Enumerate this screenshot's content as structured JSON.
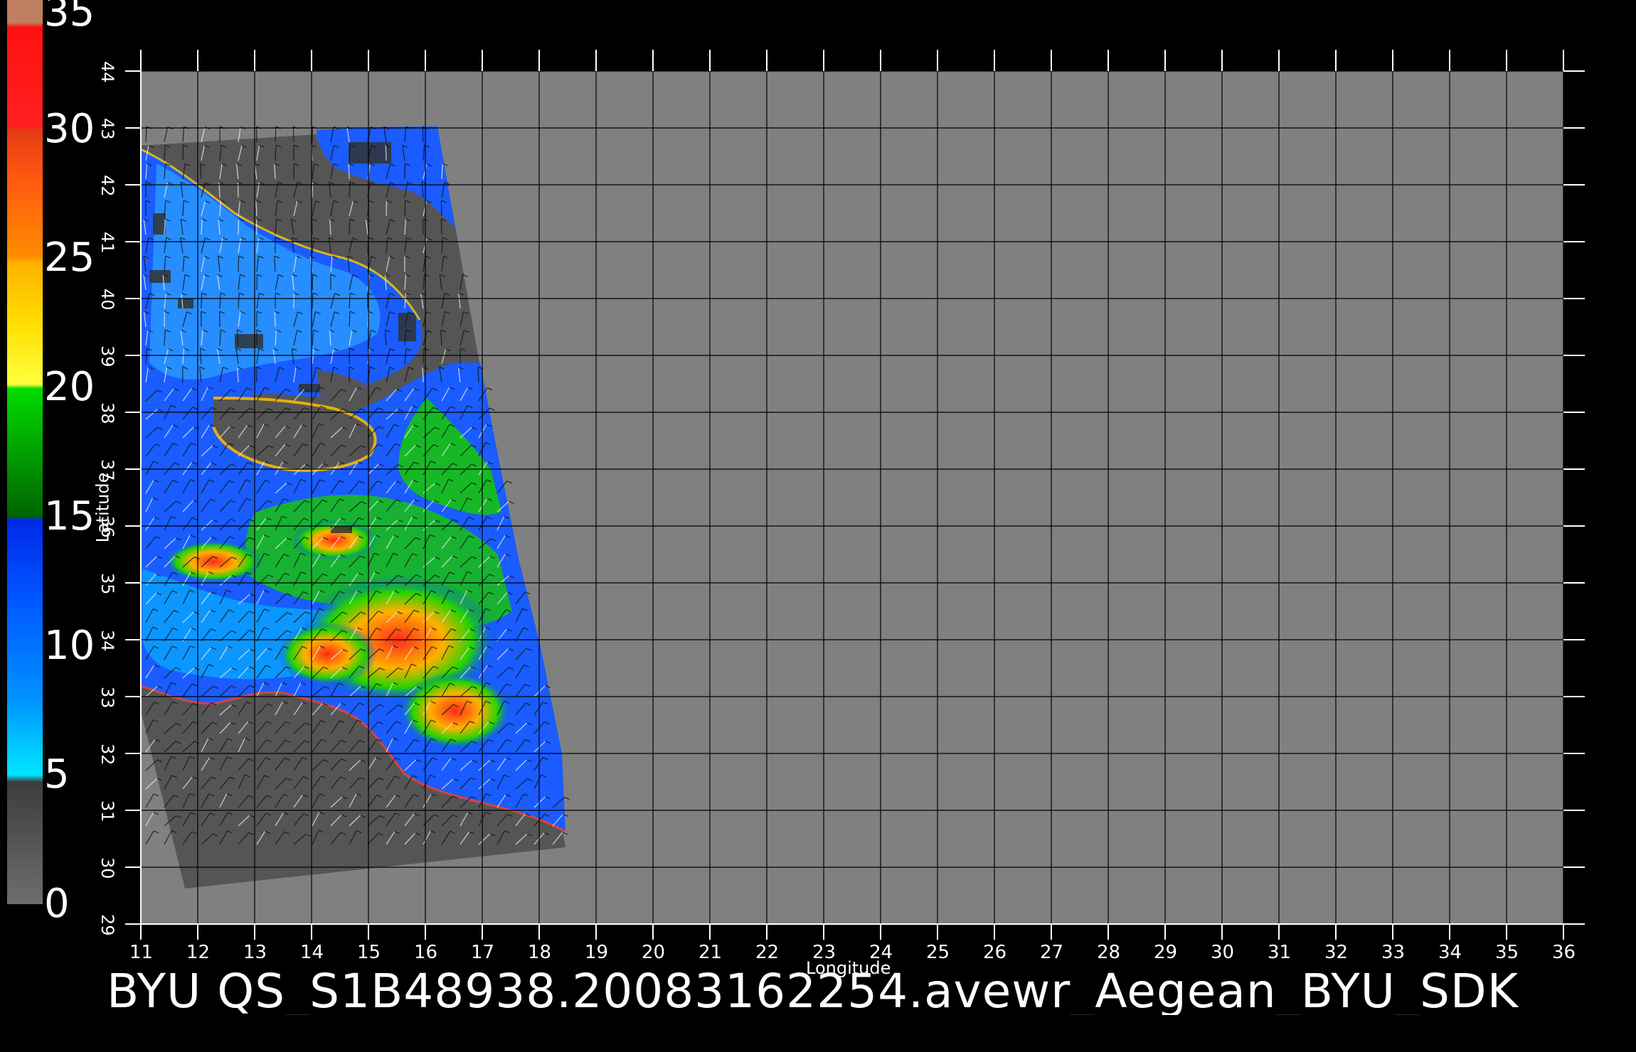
{
  "title": "BYU  QS_S1B48938.20083162254.avewr_Aegean_BYU_SDK",
  "colorbar": {
    "labels": [
      "0",
      "5",
      "10",
      "15",
      "20",
      "25",
      "30",
      "35"
    ],
    "min": 0,
    "max": 35
  },
  "axes": {
    "xlabel": "Longitude",
    "ylabel": "Latitude",
    "lon_range": [
      11,
      36
    ],
    "lat_range": [
      29,
      44
    ],
    "lon_ticks": [
      "11",
      "12",
      "13",
      "14",
      "15",
      "16",
      "17",
      "18",
      "19",
      "20",
      "21",
      "22",
      "23",
      "24",
      "25",
      "26",
      "27",
      "28",
      "29",
      "30",
      "31",
      "32",
      "33",
      "34",
      "35",
      "36"
    ],
    "lat_ticks": [
      "29",
      "30",
      "31",
      "32",
      "33",
      "34",
      "35",
      "36",
      "37",
      "38",
      "39",
      "40",
      "41",
      "42",
      "43",
      "44"
    ]
  },
  "colors": {
    "background": "#000000",
    "map_gray": "#808080",
    "swath_gray": "#555555",
    "land_dark": "#3a3a3a",
    "grid": "#000000",
    "tick": "#ffffff"
  }
}
